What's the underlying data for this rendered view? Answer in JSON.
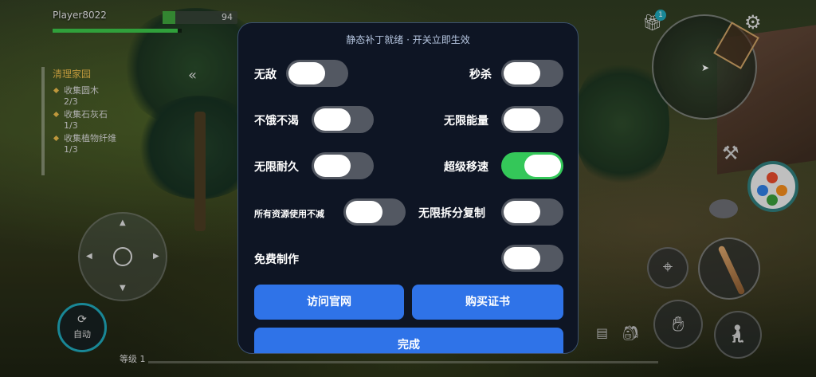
{
  "hud": {
    "player_name": "Player8022",
    "player_level": "94",
    "health": 0.97,
    "quest": {
      "title": "清理家园",
      "items": [
        {
          "label": "收集圆木",
          "progress": "2/3"
        },
        {
          "label": "收集石灰石",
          "progress": "1/3"
        },
        {
          "label": "收集植物纤维",
          "progress": "1/3"
        }
      ]
    },
    "auto_label": "自动",
    "level_label": "等级 1",
    "gift_badge": "1",
    "icons": {
      "gift": "gift-icon",
      "settings": "gear-icon",
      "crafting": "crafting-flower-icon",
      "target": "target-icon",
      "weapon": "bat-weapon-icon",
      "grab": "hand-icon",
      "sneak": "sneak-icon",
      "bag": "backpack-icon"
    }
  },
  "cheat_panel": {
    "title": "静态补丁就绪 · 开关立即生效",
    "toggles": [
      {
        "label": "无敌",
        "on": false
      },
      {
        "label": "秒杀",
        "on": false
      },
      {
        "label": "不饿不渴",
        "on": false
      },
      {
        "label": "无限能量",
        "on": false
      },
      {
        "label": "无限耐久",
        "on": false
      },
      {
        "label": "超级移速",
        "on": true
      },
      {
        "label": "所有资源使用不减",
        "on": false
      },
      {
        "label": "无限拆分复制",
        "on": false
      },
      {
        "label": "免费制作",
        "on": false
      }
    ],
    "buttons": {
      "website": "访问官网",
      "buy": "购买证书",
      "done": "完成"
    },
    "colors": {
      "toggle_on": "#34c759",
      "toggle_off": "#535862",
      "button": "#2f73e8",
      "panel": "#0e1524"
    }
  }
}
